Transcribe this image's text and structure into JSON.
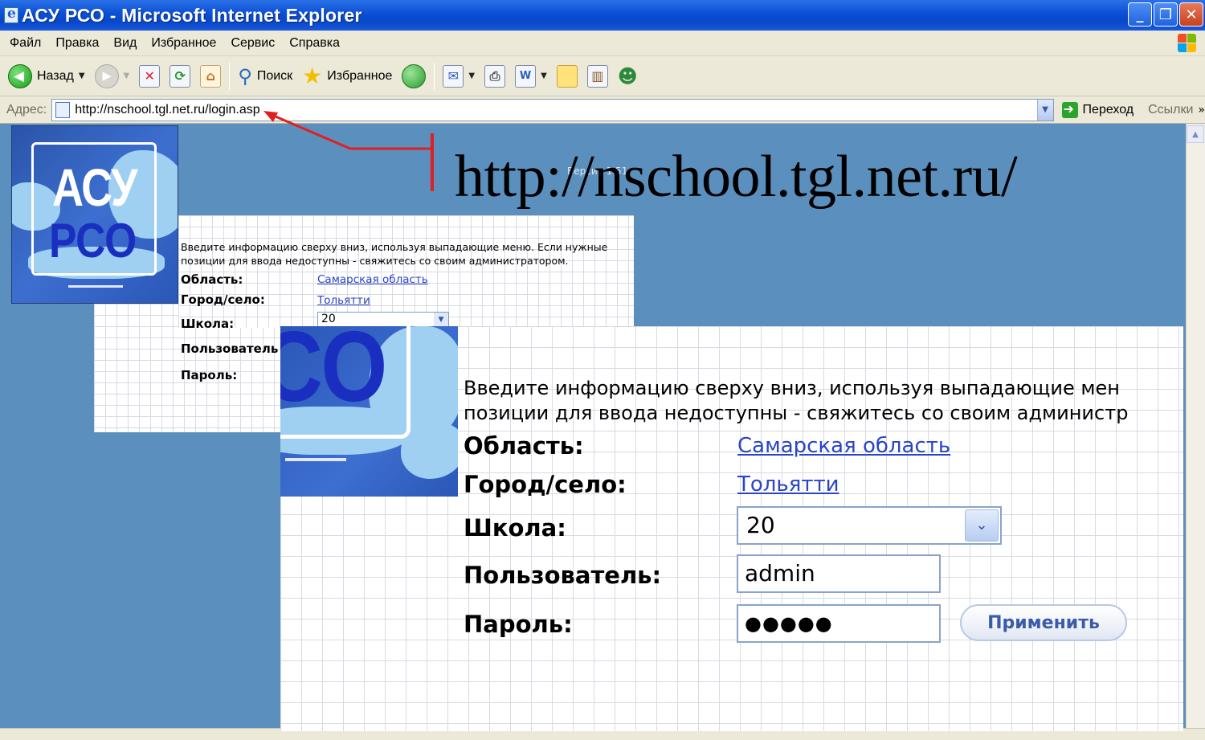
{
  "window": {
    "title": "АСУ РСО - Microsoft Internet Explorer"
  },
  "menu": [
    "Файл",
    "Правка",
    "Вид",
    "Избранное",
    "Сервис",
    "Справка"
  ],
  "toolbar": {
    "back": "Назад",
    "search": "Поиск",
    "favorites": "Избранное"
  },
  "address": {
    "label": "Адрес:",
    "url": "http://nschool.tgl.net.ru/login.asp",
    "go": "Переход",
    "links": "Ссылки"
  },
  "annotation": {
    "url": "http://nschool.tgl.net.ru/"
  },
  "page": {
    "version": "Версия 1.51",
    "logo_top": "АСУ",
    "logo_bottom": "РСО",
    "logo_zoom": "СО",
    "intro_line1": "Введите информацию сверху вниз, используя выпадающие меню. Если нужные",
    "intro_line2": "позиции для ввода недоступны - свяжитесь со своим администратором.",
    "zoom_intro_line1": "Введите информацию сверху вниз, используя выпадающие мен",
    "zoom_intro_line2": "позиции для ввода недоступны - свяжитесь со своим администр",
    "region_label": "Область:",
    "region_value": "Самарская область",
    "city_label": "Город/село:",
    "city_value": "Тольятти",
    "school_label": "Школа:",
    "school_value": "20",
    "user_label": "Пользователь:",
    "user_label_cut": "Пользователь",
    "user_value": "admin",
    "password_label": "Пароль:",
    "password_value": "●●●●●",
    "submit": "Применить"
  },
  "colors": {
    "titlebar": "#0a4fd6",
    "page_bg": "#5b8fbe",
    "link": "#2a44c8",
    "arrow": "#e02020"
  }
}
